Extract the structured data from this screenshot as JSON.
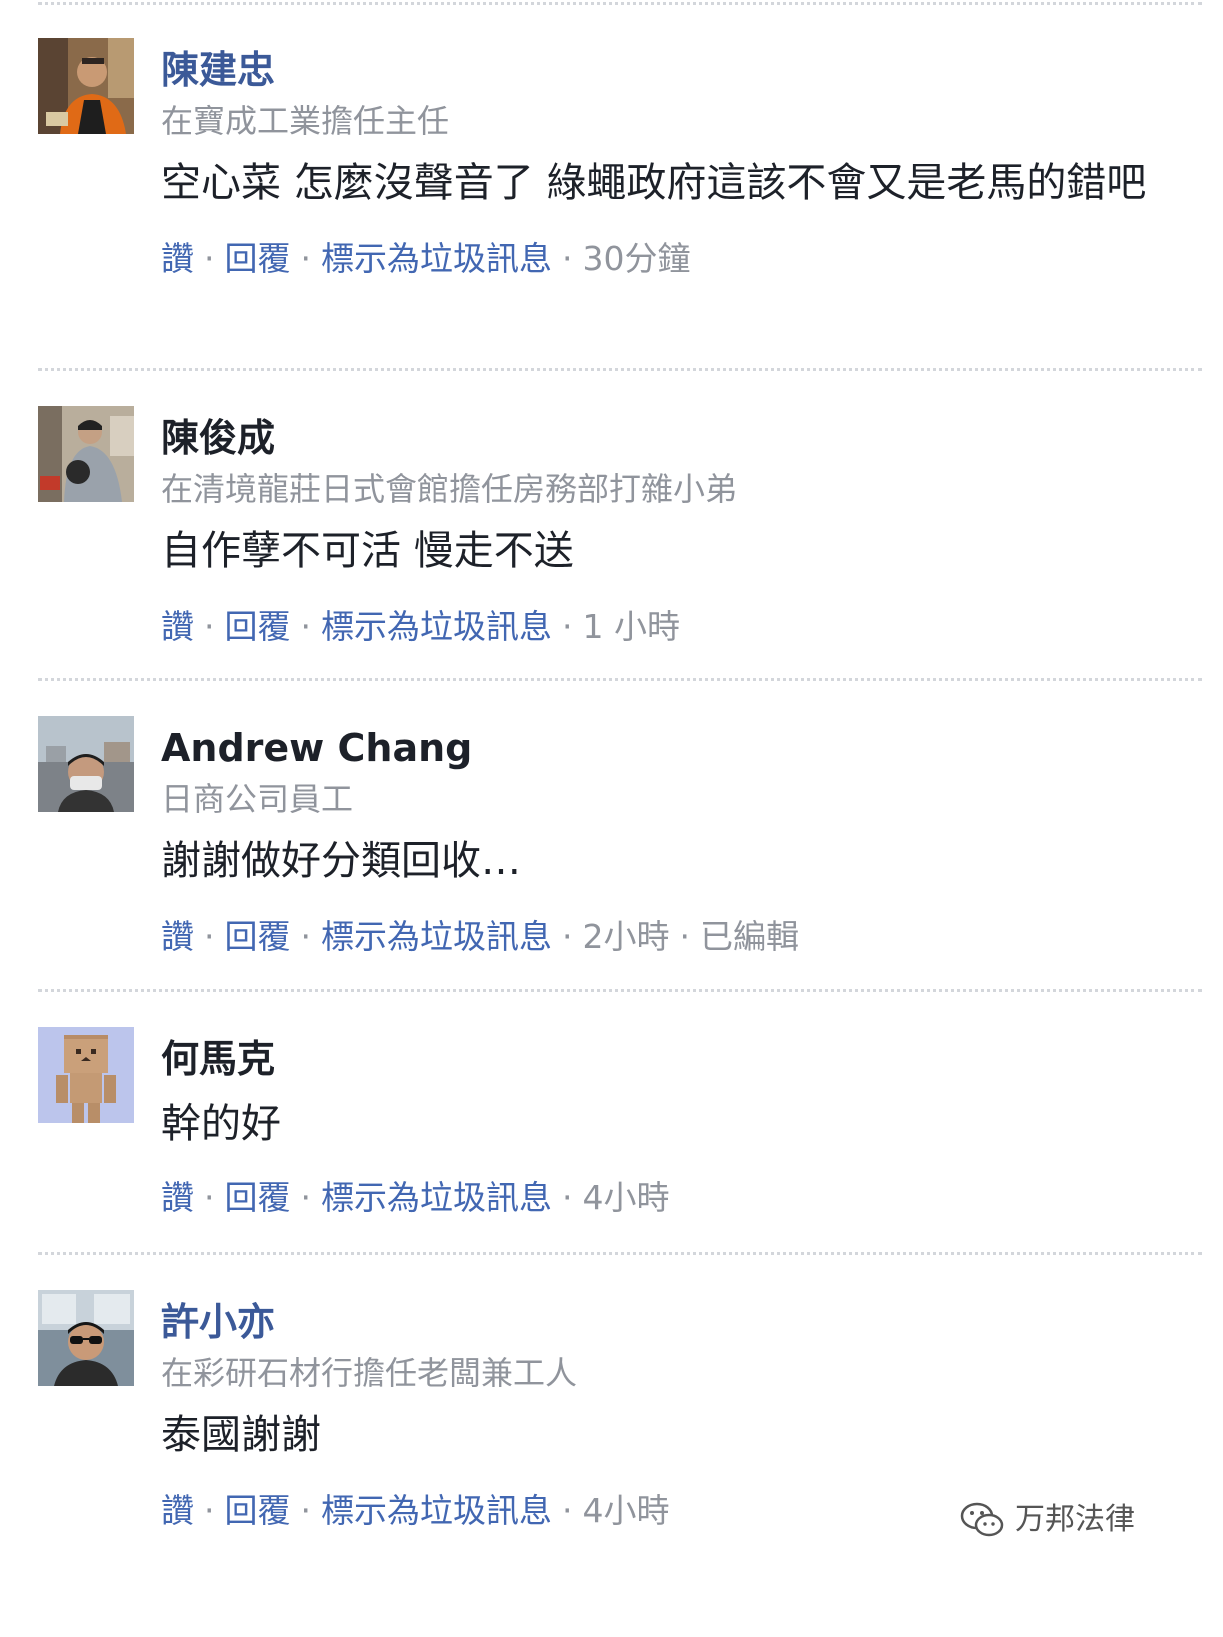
{
  "colors": {
    "name_link": "#3b5998",
    "action_link": "#4267b2",
    "meta_gray": "#90949c",
    "text": "#1d2129",
    "divider": "#d3d6db"
  },
  "actions": {
    "like": "讚",
    "reply": "回覆",
    "mark_spam": "標示為垃圾訊息",
    "separator": "·"
  },
  "comments": [
    {
      "name": "陳建忠",
      "subtitle": "在寶成工業擔任主任",
      "text": "空心菜 怎麼沒聲音了 綠蠅政府這該不會又是老馬的錯吧",
      "time": "30分鐘",
      "edited": ""
    },
    {
      "name": "陳俊成",
      "subtitle": "在清境龍莊日式會館擔任房務部打雜小弟",
      "text": "自作孽不可活 慢走不送",
      "time": "1 小時",
      "edited": ""
    },
    {
      "name": "Andrew Chang",
      "subtitle": "日商公司員工",
      "text": "謝謝做好分類回收…",
      "time": "2小時",
      "edited": "已編輯"
    },
    {
      "name": "何馬克",
      "subtitle": "",
      "text": "幹的好",
      "time": "4小時",
      "edited": ""
    },
    {
      "name": "許小亦",
      "subtitle": "在彩研石材行擔任老闆兼工人",
      "text": "泰國謝謝",
      "time": "4小時",
      "edited": ""
    }
  ],
  "watermark": {
    "text": "万邦法律",
    "icon": "wechat-icon"
  }
}
